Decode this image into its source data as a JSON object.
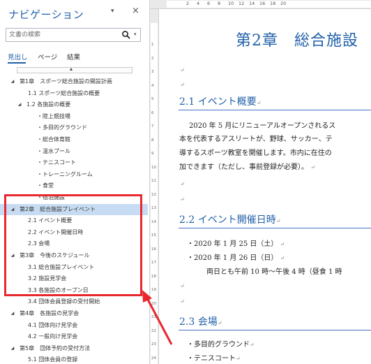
{
  "nav": {
    "title": "ナビゲーション",
    "dropdown_glyph": "▾",
    "close_glyph": "×",
    "search_placeholder": "文書の検索",
    "search_dd_glyph": "▾",
    "tabs": [
      "見出し",
      "ページ",
      "結果"
    ],
    "collapse_glyph": "▴",
    "items": [
      {
        "tri": "◢",
        "text": "第1章　スポーツ総合施設の開設計画"
      },
      {
        "tri": "",
        "text": "1.1 スポーツ総合施設の概要"
      },
      {
        "tri": "◢",
        "text": "1.2 各施設の概要"
      },
      {
        "tri": "",
        "text": "・陸上競技場"
      },
      {
        "tri": "",
        "text": "・多目的グラウンド"
      },
      {
        "tri": "",
        "text": "・総合体育館"
      },
      {
        "tri": "",
        "text": "・温水プール"
      },
      {
        "tri": "",
        "text": "・テニスコート"
      },
      {
        "tri": "",
        "text": "・トレーニングルーム"
      },
      {
        "tri": "",
        "text": "・食堂"
      },
      {
        "tri": "",
        "text": "・宿泊施設"
      },
      {
        "tri": "◢",
        "text": "第2章　総合施設プレイベント"
      },
      {
        "tri": "",
        "text": "2.1 イベント概要"
      },
      {
        "tri": "",
        "text": "2.2 イベント開催日時"
      },
      {
        "tri": "",
        "text": "2.3 会場"
      },
      {
        "tri": "◢",
        "text": "第3章　今後のスケジュール"
      },
      {
        "tri": "",
        "text": "3.1 総合施設プレイベント"
      },
      {
        "tri": "",
        "text": "3.2 施設見学会"
      },
      {
        "tri": "",
        "text": "3.3 各施設のオープン日"
      },
      {
        "tri": "",
        "text": "3.4 団体会員登録の受付開始"
      },
      {
        "tri": "◢",
        "text": "第4章　各施設の見学会"
      },
      {
        "tri": "",
        "text": "4.1 団体向け見学会"
      },
      {
        "tri": "",
        "text": "4.2 一般向け見学会"
      },
      {
        "tri": "◢",
        "text": "第5章　団体予約の受付方法"
      },
      {
        "tri": "",
        "text": "5.1 団体会員の登録"
      },
      {
        "tri": "",
        "text": "5.2 団体予約の受付開始"
      }
    ],
    "selected_index": 11
  },
  "ruler": {
    "top_numbers": [
      "2",
      "4",
      "6",
      "8",
      "10",
      "12",
      "14",
      "16",
      "18",
      "20"
    ],
    "left_numbers": [
      "1",
      "2",
      "3",
      "4",
      "5",
      "6",
      "7",
      "8",
      "9",
      "10",
      "11",
      "12",
      "13",
      "14",
      "15",
      "16",
      "17",
      "18",
      "19",
      "20",
      "21",
      "22",
      "23",
      "24"
    ]
  },
  "doc": {
    "chapter_title": "第2章　総合施設",
    "para_mark": "↵",
    "h_event_overview": "2.1 イベント概要",
    "overview_lines": [
      "2020 年 5 月にリニューアルオープンされるス",
      "本を代表するアスリートが、野球、サッカー、テ",
      "導するスポーツ教室を開催します。市内に在住の",
      "加できます（ただし、事前登録が必要）。"
    ],
    "h_event_dates": "2.2 イベント開催日時",
    "date_lines": [
      "・2020 年 1 月 25 日（土）",
      "・2020 年 1 月 26 日（日）",
      "両日とも午前 10 時～午後 4 時（昼食 1 時"
    ],
    "h_venue": "2.3 会場",
    "venue_lines": [
      "・多目的グラウンド",
      "・テニスコート"
    ]
  },
  "colors": {
    "accent": "#1f5fa8",
    "highlight_box": "#e8272e",
    "selection": "#c7dcf2"
  }
}
